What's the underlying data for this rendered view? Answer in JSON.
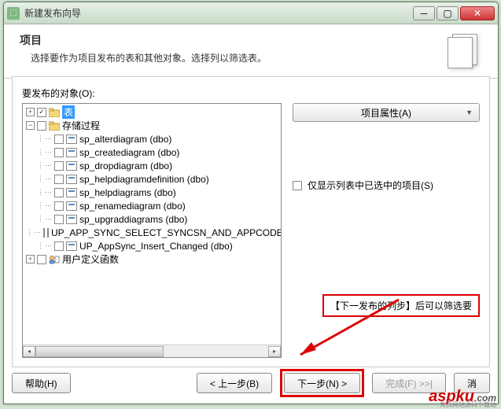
{
  "window": {
    "title": "新建发布向导"
  },
  "header": {
    "title": "项目",
    "desc": "选择要作为项目发布的表和其他对象。选择列以筛选表。"
  },
  "objects_label": "要发布的对象(O):",
  "tree": {
    "root_tables": "表",
    "root_procs": "存储过程",
    "procs": [
      "sp_alterdiagram (dbo)",
      "sp_creatediagram (dbo)",
      "sp_dropdiagram (dbo)",
      "sp_helpdiagramdefinition (dbo)",
      "sp_helpdiagrams (dbo)",
      "sp_renamediagram (dbo)",
      "sp_upgraddiagrams (dbo)",
      "UP_APP_SYNC_SELECT_SYNCSN_AND_APPCODE_BY_",
      "UP_AppSync_Insert_Changed (dbo)"
    ],
    "root_udf": "用户定义函数"
  },
  "right": {
    "properties_btn": "项目属性(A)",
    "filter_label": "仅显示列表中已选中的项目(S)"
  },
  "tip": "【下一发布的列步】后可以筛选要",
  "footer": {
    "help": "帮助(H)",
    "back": "< 上一步(B)",
    "next": "下一步(N) >",
    "finish": "完成(F) >>|",
    "cancel": "消"
  },
  "watermark": "aspku",
  "watermark_suffix": ".com",
  "watermark_sub": "免费网站源码下载站"
}
